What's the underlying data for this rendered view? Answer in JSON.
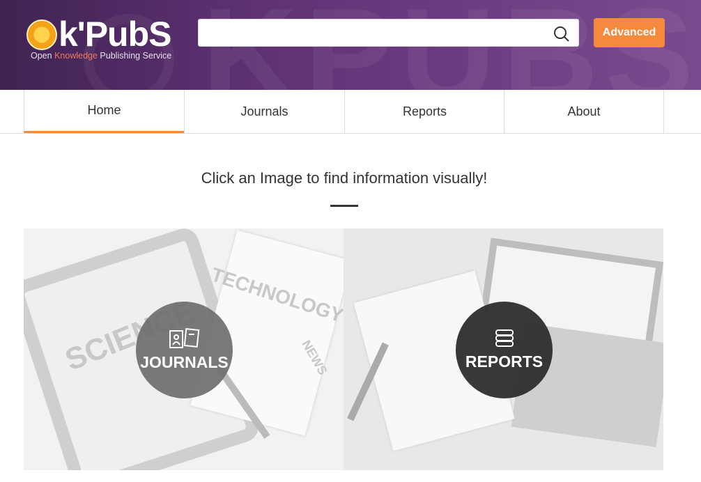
{
  "header": {
    "logo_text": "k'PubS",
    "logo_prefix": "O",
    "tagline_open": "Open",
    "tagline_knowledge": "Knowledge",
    "tagline_rest": "Publishing Service",
    "search_placeholder": "",
    "search_value": "",
    "advanced_label": "Advanced",
    "watermark": "KPUBS"
  },
  "nav": {
    "tabs": [
      {
        "label": "Home",
        "active": true
      },
      {
        "label": "Journals"
      },
      {
        "label": "Reports"
      },
      {
        "label": "About"
      }
    ]
  },
  "main": {
    "lead": "Click an Image to find information visually!",
    "cards": [
      {
        "label": "JOURNALS",
        "icon": "journals-icon",
        "illustration": {
          "a": "SCIENCE",
          "b": "TECHNOLOGY",
          "c": "NEWS"
        }
      },
      {
        "label": "REPORTS",
        "icon": "books-stack-icon"
      }
    ]
  },
  "colors": {
    "accent": "#f58a3c",
    "header": "#5a2f6e"
  }
}
